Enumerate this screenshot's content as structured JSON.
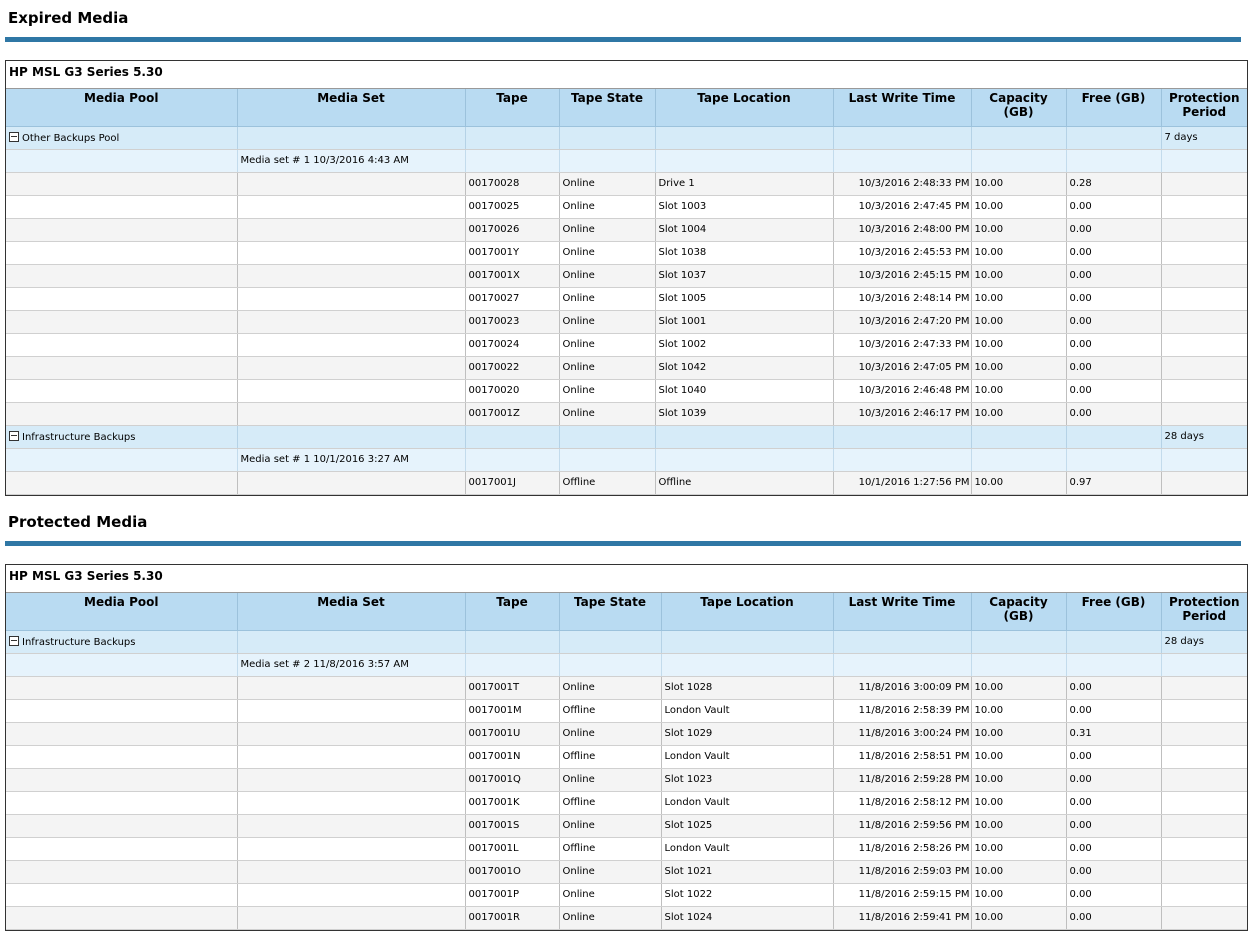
{
  "columns": [
    "Media Pool",
    "Media Set",
    "Tape",
    "Tape State",
    "Tape Location",
    "Last Write Time",
    "Capacity (GB)",
    "Free (GB)",
    "Protection Period"
  ],
  "expired": {
    "title": "Expired Media",
    "device": "HP MSL G3 Series 5.30",
    "pools": [
      {
        "name": "Other Backups Pool",
        "protection": "7 days",
        "media_set": "Media set # 1 10/3/2016 4:43 AM",
        "tapes": [
          [
            "00170028",
            "Online",
            "Drive 1",
            "10/3/2016 2:48:33 PM",
            "10.00",
            "0.28"
          ],
          [
            "00170025",
            "Online",
            "Slot 1003",
            "10/3/2016 2:47:45 PM",
            "10.00",
            "0.00"
          ],
          [
            "00170026",
            "Online",
            "Slot 1004",
            "10/3/2016 2:48:00 PM",
            "10.00",
            "0.00"
          ],
          [
            "0017001Y",
            "Online",
            "Slot 1038",
            "10/3/2016 2:45:53 PM",
            "10.00",
            "0.00"
          ],
          [
            "0017001X",
            "Online",
            "Slot 1037",
            "10/3/2016 2:45:15 PM",
            "10.00",
            "0.00"
          ],
          [
            "00170027",
            "Online",
            "Slot 1005",
            "10/3/2016 2:48:14 PM",
            "10.00",
            "0.00"
          ],
          [
            "00170023",
            "Online",
            "Slot 1001",
            "10/3/2016 2:47:20 PM",
            "10.00",
            "0.00"
          ],
          [
            "00170024",
            "Online",
            "Slot 1002",
            "10/3/2016 2:47:33 PM",
            "10.00",
            "0.00"
          ],
          [
            "00170022",
            "Online",
            "Slot 1042",
            "10/3/2016 2:47:05 PM",
            "10.00",
            "0.00"
          ],
          [
            "00170020",
            "Online",
            "Slot 1040",
            "10/3/2016 2:46:48 PM",
            "10.00",
            "0.00"
          ],
          [
            "0017001Z",
            "Online",
            "Slot 1039",
            "10/3/2016 2:46:17 PM",
            "10.00",
            "0.00"
          ]
        ]
      },
      {
        "name": "Infrastructure Backups",
        "protection": "28 days",
        "media_set": "Media set # 1 10/1/2016 3:27 AM",
        "tapes": [
          [
            "0017001J",
            "Offline",
            "Offline",
            "10/1/2016 1:27:56 PM",
            "10.00",
            "0.97"
          ]
        ]
      }
    ]
  },
  "protected": {
    "title": "Protected Media",
    "device": "HP MSL G3 Series 5.30",
    "pools": [
      {
        "name": "Infrastructure Backups",
        "protection": "28 days",
        "media_set": "Media set # 2 11/8/2016 3:57 AM",
        "tapes": [
          [
            "0017001T",
            "Online",
            "Slot 1028",
            "11/8/2016 3:00:09 PM",
            "10.00",
            "0.00"
          ],
          [
            "0017001M",
            "Offline",
            "London Vault",
            "11/8/2016 2:58:39 PM",
            "10.00",
            "0.00"
          ],
          [
            "0017001U",
            "Online",
            "Slot 1029",
            "11/8/2016 3:00:24 PM",
            "10.00",
            "0.31"
          ],
          [
            "0017001N",
            "Offline",
            "London Vault",
            "11/8/2016 2:58:51 PM",
            "10.00",
            "0.00"
          ],
          [
            "0017001Q",
            "Online",
            "Slot 1023",
            "11/8/2016 2:59:28 PM",
            "10.00",
            "0.00"
          ],
          [
            "0017001K",
            "Offline",
            "London Vault",
            "11/8/2016 2:58:12 PM",
            "10.00",
            "0.00"
          ],
          [
            "0017001S",
            "Online",
            "Slot 1025",
            "11/8/2016 2:59:56 PM",
            "10.00",
            "0.00"
          ],
          [
            "0017001L",
            "Offline",
            "London Vault",
            "11/8/2016 2:58:26 PM",
            "10.00",
            "0.00"
          ],
          [
            "0017001O",
            "Online",
            "Slot 1021",
            "11/8/2016 2:59:03 PM",
            "10.00",
            "0.00"
          ],
          [
            "0017001P",
            "Online",
            "Slot 1022",
            "11/8/2016 2:59:15 PM",
            "10.00",
            "0.00"
          ],
          [
            "0017001R",
            "Online",
            "Slot 1024",
            "11/8/2016 2:59:41 PM",
            "10.00",
            "0.00"
          ]
        ]
      }
    ]
  }
}
